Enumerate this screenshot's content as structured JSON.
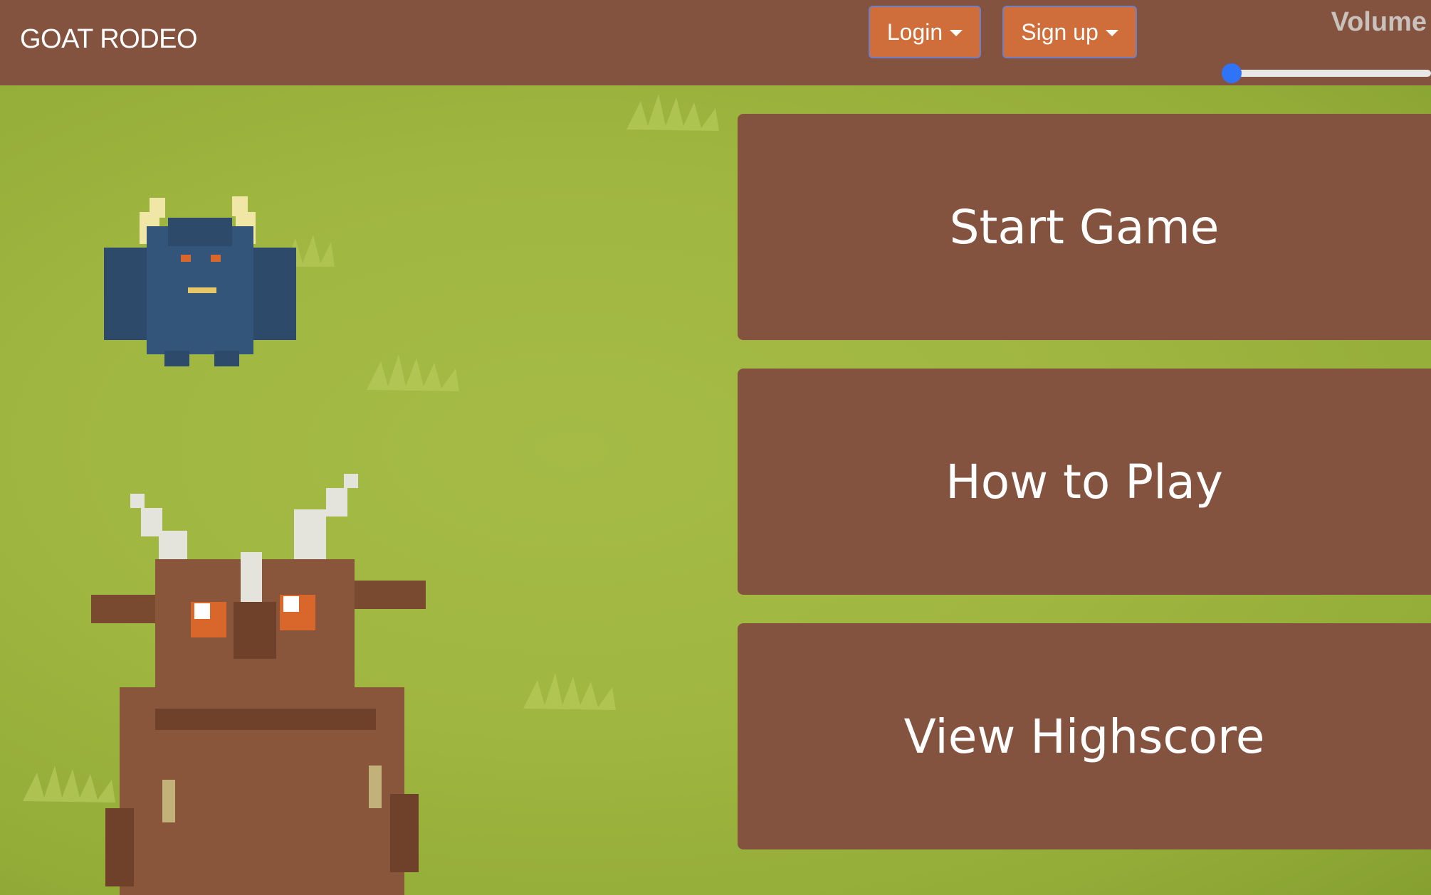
{
  "navbar": {
    "brand": "GOAT RODEO",
    "login_label": "Login",
    "signup_label": "Sign up",
    "volume_label": "Volume",
    "volume_level": 0
  },
  "menu": {
    "start_label": "Start Game",
    "howto_label": "How to Play",
    "highscore_label": "View Highscore"
  },
  "colors": {
    "navbar_bg": "#845340",
    "nav_button_bg": "#cf6e3b",
    "grass": "#9fb640",
    "menu_button_bg": "#845340",
    "slider_thumb": "#2f74f6"
  },
  "sprites": {
    "enemy": "blue-minotaur-icon",
    "player": "brown-goat-icon"
  }
}
